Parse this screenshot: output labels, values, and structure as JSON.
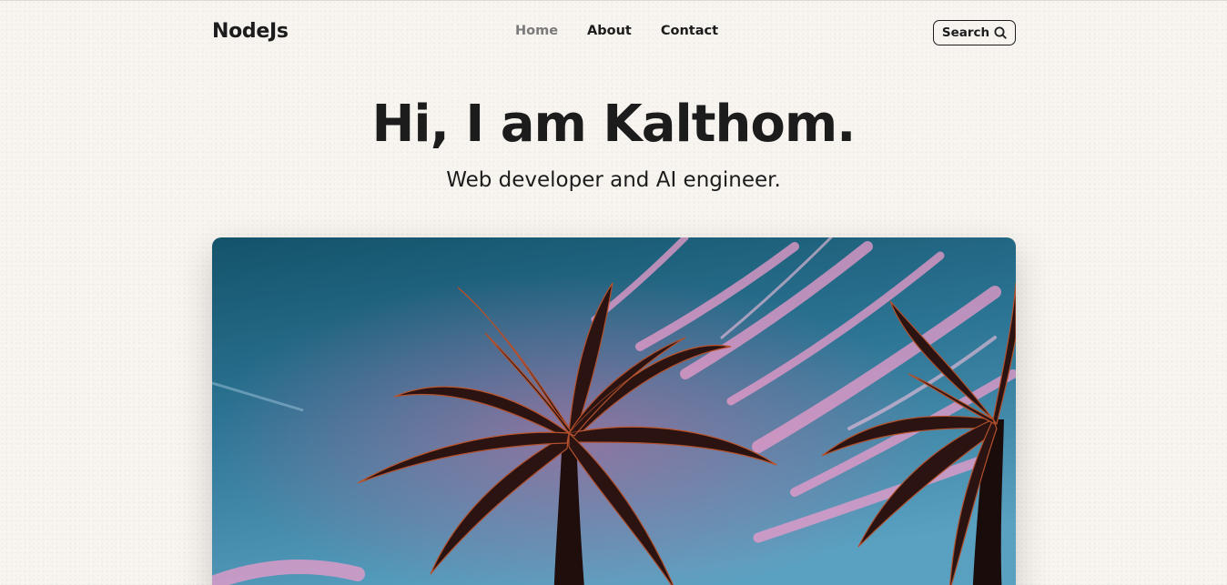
{
  "header": {
    "logo": "NodeJs",
    "nav": [
      {
        "label": "Home",
        "active": true
      },
      {
        "label": "About",
        "active": false
      },
      {
        "label": "Contact",
        "active": false
      }
    ],
    "search_label": "Search",
    "search_icon": "search-icon"
  },
  "hero": {
    "title": "Hi, I am Kalthom.",
    "subtitle": "Web developer and AI engineer."
  },
  "colors": {
    "background": "#f8f5f0",
    "text": "#1c1c1c",
    "nav_active": "#7a7a7a",
    "sky_top": "#14536a",
    "sky_bottom": "#4f98ba",
    "cloud_pink": "#e69ac4",
    "palm_dark": "#2a1210",
    "palm_rust": "#b7512e"
  }
}
